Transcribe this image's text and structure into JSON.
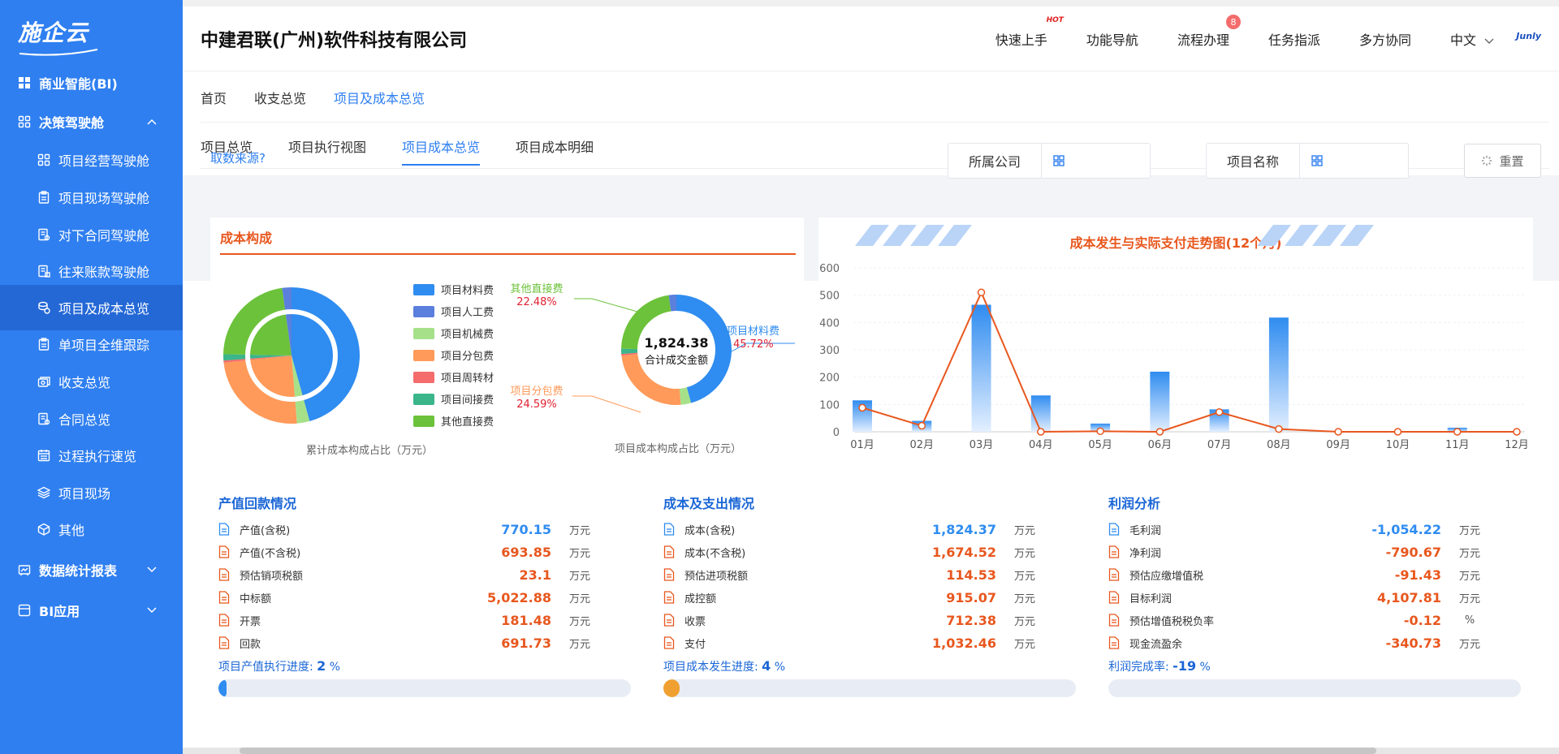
{
  "sidebar": {
    "logo": "施企云",
    "items": [
      {
        "label": "商业智能(BI)",
        "level": "top",
        "icon": "grid-icon"
      },
      {
        "label": "决策驾驶舱",
        "level": "top",
        "icon": "grid-outline-icon",
        "caret": "up"
      },
      {
        "label": "项目经营驾驶舱",
        "level": "sub",
        "icon": "grid-outline-icon"
      },
      {
        "label": "项目现场驾驶舱",
        "level": "sub",
        "icon": "clipboard-icon"
      },
      {
        "label": "对下合同驾驶舱",
        "level": "sub",
        "icon": "contract-icon"
      },
      {
        "label": "往来账款驾驶舱",
        "level": "sub",
        "icon": "ledger-icon"
      },
      {
        "label": "项目及成本总览",
        "level": "sub",
        "icon": "coins-icon",
        "active": true
      },
      {
        "label": "单项目全维跟踪",
        "level": "sub",
        "icon": "clipboard-icon"
      },
      {
        "label": "收支总览",
        "level": "sub",
        "icon": "money-icon"
      },
      {
        "label": "合同总览",
        "level": "sub",
        "icon": "contract-icon"
      },
      {
        "label": "过程执行速览",
        "level": "sub",
        "icon": "calendar-icon"
      },
      {
        "label": "项目现场",
        "level": "sub",
        "icon": "layers-icon"
      },
      {
        "label": "其他",
        "level": "sub",
        "icon": "cube-icon"
      },
      {
        "label": "数据统计报表",
        "level": "top",
        "icon": "report-icon",
        "caret": "down"
      },
      {
        "label": "BI应用",
        "level": "top",
        "icon": "app-icon",
        "caret": "down"
      }
    ]
  },
  "header": {
    "company": "中建君联(广州)软件科技有限公司",
    "nav": [
      {
        "label": "快速上手",
        "badge": "HOT"
      },
      {
        "label": "功能导航"
      },
      {
        "label": "流程办理",
        "count": "8"
      },
      {
        "label": "任务指派"
      },
      {
        "label": "多方协同"
      },
      {
        "label": "中文",
        "caret": "down"
      }
    ],
    "brand": "Junly"
  },
  "tabs_primary": [
    {
      "label": "首页"
    },
    {
      "label": "收支总览"
    },
    {
      "label": "项目及成本总览",
      "active": true
    }
  ],
  "tabs_secondary": [
    {
      "label": "项目总览"
    },
    {
      "label": "项目执行视图"
    },
    {
      "label": "项目成本总览",
      "active": true
    },
    {
      "label": "项目成本明细"
    }
  ],
  "filters": {
    "source_link": "取数来源?",
    "company_label": "所属公司",
    "project_label": "项目名称",
    "reset_label": "重置"
  },
  "cost_panel": {
    "title": "成本构成",
    "legend": [
      {
        "name": "项目材料费",
        "color": "#2f8cf0"
      },
      {
        "name": "项目人工费",
        "color": "#5b7fdc"
      },
      {
        "name": "项目机械费",
        "color": "#a6e18a"
      },
      {
        "name": "项目分包费",
        "color": "#ff9a5a"
      },
      {
        "name": "项目周转材",
        "color": "#f56c6c"
      },
      {
        "name": "项目间接费",
        "color": "#3bb58a"
      },
      {
        "name": "其他直接费",
        "color": "#6cc23a"
      }
    ],
    "pie_caption": "累计成本构成占比（万元）",
    "donut_caption": "项目成本构成占比（万元）",
    "donut_total": "1,824.38",
    "donut_total_label": "合计成交金额",
    "callouts": [
      {
        "name": "其他直接费",
        "pct": "22.48%",
        "color": "#6cc23a"
      },
      {
        "name": "项目材料费",
        "pct": "45.72%",
        "color": "#2f8cf0"
      },
      {
        "name": "项目分包费",
        "pct": "24.59%",
        "color": "#ff9a5a"
      }
    ]
  },
  "chart_data": {
    "type": "bar",
    "title": "成本发生与实际支付走势图(12个月)",
    "categories": [
      "01月",
      "02月",
      "03月",
      "04月",
      "05月",
      "06月",
      "07月",
      "08月",
      "09月",
      "10月",
      "11月",
      "12月"
    ],
    "ylim": [
      0,
      600
    ],
    "yticks": [
      0,
      100,
      200,
      300,
      400,
      500,
      600
    ],
    "series": [
      {
        "kind": "bar",
        "color": "#2f8cf0",
        "values": [
          115,
          40,
          465,
          133,
          30,
          220,
          82,
          418,
          0,
          0,
          15,
          0
        ]
      },
      {
        "kind": "line",
        "color": "#e8571e",
        "values": [
          88,
          22,
          510,
          0,
          2,
          0,
          72,
          10,
          0,
          0,
          0,
          0
        ]
      }
    ],
    "grid": true
  },
  "stats": [
    {
      "title": "产值回款情况",
      "rows": [
        {
          "label": "产值(含税)",
          "value": "770.15",
          "unit": "万元",
          "color": "#2f8cf0",
          "icon_color": "#2f8cf0"
        },
        {
          "label": "产值(不含税)",
          "value": "693.85",
          "unit": "万元",
          "color": "#e8571e",
          "icon_color": "#e8571e"
        },
        {
          "label": "预估销项税额",
          "value": "23.1",
          "unit": "万元",
          "color": "#e8571e",
          "icon_color": "#e8571e"
        },
        {
          "label": "中标额",
          "value": "5,022.88",
          "unit": "万元",
          "color": "#e8571e",
          "icon_color": "#e8571e"
        },
        {
          "label": "开票",
          "value": "181.48",
          "unit": "万元",
          "color": "#e8571e",
          "icon_color": "#e8571e"
        },
        {
          "label": "回款",
          "value": "691.73",
          "unit": "万元",
          "color": "#e8571e",
          "icon_color": "#e8571e"
        }
      ],
      "progress_label": "项目产值执行进度:",
      "progress_value": "2",
      "progress_unit": "%",
      "progress_fraction": 0.02,
      "progress_color": "#2f8cf0"
    },
    {
      "title": "成本及支出情况",
      "rows": [
        {
          "label": "成本(含税)",
          "value": "1,824.37",
          "unit": "万元",
          "color": "#2f8cf0",
          "icon_color": "#2f8cf0"
        },
        {
          "label": "成本(不含税)",
          "value": "1,674.52",
          "unit": "万元",
          "color": "#e8571e",
          "icon_color": "#e8571e"
        },
        {
          "label": "预估进项税额",
          "value": "114.53",
          "unit": "万元",
          "color": "#e8571e",
          "icon_color": "#e8571e"
        },
        {
          "label": "成控额",
          "value": "915.07",
          "unit": "万元",
          "color": "#e8571e",
          "icon_color": "#e8571e"
        },
        {
          "label": "收票",
          "value": "712.38",
          "unit": "万元",
          "color": "#e8571e",
          "icon_color": "#e8571e"
        },
        {
          "label": "支付",
          "value": "1,032.46",
          "unit": "万元",
          "color": "#e8571e",
          "icon_color": "#e8571e"
        }
      ],
      "progress_label": "项目成本发生进度:",
      "progress_value": "4",
      "progress_unit": "%",
      "progress_fraction": 0.04,
      "progress_color": "#f0a030"
    },
    {
      "title": "利润分析",
      "rows": [
        {
          "label": "毛利润",
          "value": "-1,054.22",
          "unit": "万元",
          "color": "#2f8cf0",
          "icon_color": "#2f8cf0"
        },
        {
          "label": "净利润",
          "value": "-790.67",
          "unit": "万元",
          "color": "#e8571e",
          "icon_color": "#e8571e"
        },
        {
          "label": "预估应缴增值税",
          "value": "-91.43",
          "unit": "万元",
          "color": "#e8571e",
          "icon_color": "#e8571e"
        },
        {
          "label": "目标利润",
          "value": "4,107.81",
          "unit": "万元",
          "color": "#e8571e",
          "icon_color": "#e8571e"
        },
        {
          "label": "预估增值税税负率",
          "value": "-0.12",
          "unit": "%",
          "color": "#e8571e",
          "icon_color": "#e8571e"
        },
        {
          "label": "现金流盈余",
          "value": "-340.73",
          "unit": "万元",
          "color": "#e8571e",
          "icon_color": "#e8571e"
        }
      ],
      "progress_label": "利润完成率:",
      "progress_value": "-19",
      "progress_unit": "%",
      "progress_fraction": 0,
      "progress_color": "#2f8cf0"
    }
  ]
}
